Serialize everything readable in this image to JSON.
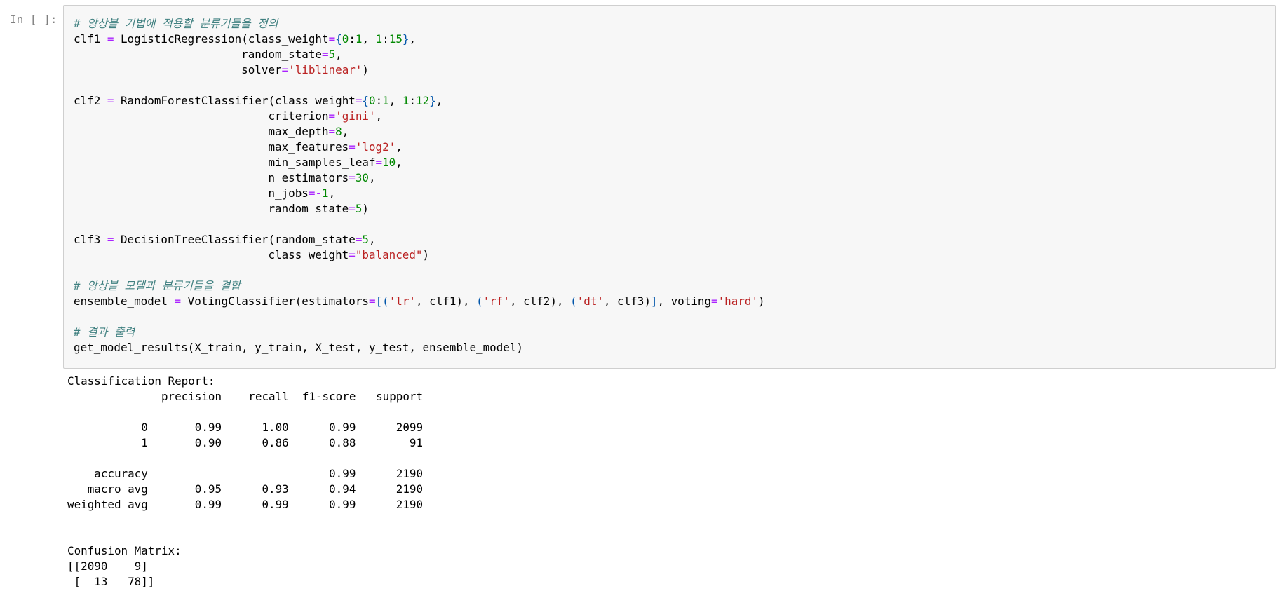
{
  "cell": {
    "prompt": "In [ ]:",
    "code_lines": [
      [
        {
          "t": "# 앙상블 기법에 적용할 분류기들을 정의",
          "c": "comment"
        }
      ],
      [
        {
          "t": "clf1 ",
          "c": ""
        },
        {
          "t": "=",
          "c": "op"
        },
        {
          "t": " LogisticRegression(class_weight",
          "c": ""
        },
        {
          "t": "=",
          "c": "op"
        },
        {
          "t": "{",
          "c": "punct"
        },
        {
          "t": "0",
          "c": "number"
        },
        {
          "t": ":",
          "c": ""
        },
        {
          "t": "1",
          "c": "number"
        },
        {
          "t": ", ",
          "c": ""
        },
        {
          "t": "1",
          "c": "number"
        },
        {
          "t": ":",
          "c": ""
        },
        {
          "t": "15",
          "c": "number"
        },
        {
          "t": "}",
          "c": "punct"
        },
        {
          "t": ",",
          "c": ""
        }
      ],
      [
        {
          "t": "                         random_state",
          "c": ""
        },
        {
          "t": "=",
          "c": "op"
        },
        {
          "t": "5",
          "c": "number"
        },
        {
          "t": ",",
          "c": ""
        }
      ],
      [
        {
          "t": "                         solver",
          "c": ""
        },
        {
          "t": "=",
          "c": "op"
        },
        {
          "t": "'liblinear'",
          "c": "string"
        },
        {
          "t": ")",
          "c": ""
        }
      ],
      [],
      [
        {
          "t": "clf2 ",
          "c": ""
        },
        {
          "t": "=",
          "c": "op"
        },
        {
          "t": " RandomForestClassifier(class_weight",
          "c": ""
        },
        {
          "t": "=",
          "c": "op"
        },
        {
          "t": "{",
          "c": "punct"
        },
        {
          "t": "0",
          "c": "number"
        },
        {
          "t": ":",
          "c": ""
        },
        {
          "t": "1",
          "c": "number"
        },
        {
          "t": ", ",
          "c": ""
        },
        {
          "t": "1",
          "c": "number"
        },
        {
          "t": ":",
          "c": ""
        },
        {
          "t": "12",
          "c": "number"
        },
        {
          "t": "}",
          "c": "punct"
        },
        {
          "t": ",",
          "c": ""
        }
      ],
      [
        {
          "t": "                             criterion",
          "c": ""
        },
        {
          "t": "=",
          "c": "op"
        },
        {
          "t": "'gini'",
          "c": "string"
        },
        {
          "t": ",",
          "c": ""
        }
      ],
      [
        {
          "t": "                             max_depth",
          "c": ""
        },
        {
          "t": "=",
          "c": "op"
        },
        {
          "t": "8",
          "c": "number"
        },
        {
          "t": ",",
          "c": ""
        }
      ],
      [
        {
          "t": "                             max_features",
          "c": ""
        },
        {
          "t": "=",
          "c": "op"
        },
        {
          "t": "'log2'",
          "c": "string"
        },
        {
          "t": ",",
          "c": ""
        }
      ],
      [
        {
          "t": "                             min_samples_leaf",
          "c": ""
        },
        {
          "t": "=",
          "c": "op"
        },
        {
          "t": "10",
          "c": "number"
        },
        {
          "t": ",",
          "c": ""
        }
      ],
      [
        {
          "t": "                             n_estimators",
          "c": ""
        },
        {
          "t": "=",
          "c": "op"
        },
        {
          "t": "30",
          "c": "number"
        },
        {
          "t": ",",
          "c": ""
        }
      ],
      [
        {
          "t": "                             n_jobs",
          "c": ""
        },
        {
          "t": "=-",
          "c": "op"
        },
        {
          "t": "1",
          "c": "number"
        },
        {
          "t": ",",
          "c": ""
        }
      ],
      [
        {
          "t": "                             random_state",
          "c": ""
        },
        {
          "t": "=",
          "c": "op"
        },
        {
          "t": "5",
          "c": "number"
        },
        {
          "t": ")",
          "c": ""
        }
      ],
      [],
      [
        {
          "t": "clf3 ",
          "c": ""
        },
        {
          "t": "=",
          "c": "op"
        },
        {
          "t": " DecisionTreeClassifier(random_state",
          "c": ""
        },
        {
          "t": "=",
          "c": "op"
        },
        {
          "t": "5",
          "c": "number"
        },
        {
          "t": ",",
          "c": ""
        }
      ],
      [
        {
          "t": "                             class_weight",
          "c": ""
        },
        {
          "t": "=",
          "c": "op"
        },
        {
          "t": "\"balanced\"",
          "c": "string"
        },
        {
          "t": ")",
          "c": ""
        }
      ],
      [],
      [
        {
          "t": "# 앙상블 모델과 분류기들을 결합",
          "c": "comment"
        }
      ],
      [
        {
          "t": "ensemble_model ",
          "c": ""
        },
        {
          "t": "=",
          "c": "op"
        },
        {
          "t": " VotingClassifier(estimators",
          "c": ""
        },
        {
          "t": "=",
          "c": "op"
        },
        {
          "t": "[(",
          "c": "punct"
        },
        {
          "t": "'lr'",
          "c": "string"
        },
        {
          "t": ", clf1), ",
          "c": ""
        },
        {
          "t": "(",
          "c": "punct"
        },
        {
          "t": "'rf'",
          "c": "string"
        },
        {
          "t": ", clf2), ",
          "c": ""
        },
        {
          "t": "(",
          "c": "punct"
        },
        {
          "t": "'dt'",
          "c": "string"
        },
        {
          "t": ", clf3)",
          "c": ""
        },
        {
          "t": "]",
          "c": "punct"
        },
        {
          "t": ", voting",
          "c": ""
        },
        {
          "t": "=",
          "c": "op"
        },
        {
          "t": "'hard'",
          "c": "string"
        },
        {
          "t": ")",
          "c": ""
        }
      ],
      [],
      [
        {
          "t": "# 결과 출력",
          "c": "comment"
        }
      ],
      [
        {
          "t": "get_model_results(X_train, y_train, X_test, y_test, ensemble_model)",
          "c": ""
        }
      ]
    ],
    "output_lines": [
      "Classification Report:",
      "              precision    recall  f1-score   support",
      "",
      "           0       0.99      1.00      0.99      2099",
      "           1       0.90      0.86      0.88        91",
      "",
      "    accuracy                           0.99      2190",
      "   macro avg       0.95      0.93      0.94      2190",
      "weighted avg       0.99      0.99      0.99      2190",
      "",
      "",
      "Confusion Matrix:",
      "[[2090    9]",
      " [  13   78]]"
    ]
  },
  "colors": {
    "comment": "#408080",
    "string": "#ba2121",
    "number": "#008800",
    "operator": "#aa22ff",
    "punct": "#0055aa",
    "cell_background": "#f7f7f7",
    "cell_border": "#cfcfcf",
    "prompt": "#7f7f7f"
  }
}
